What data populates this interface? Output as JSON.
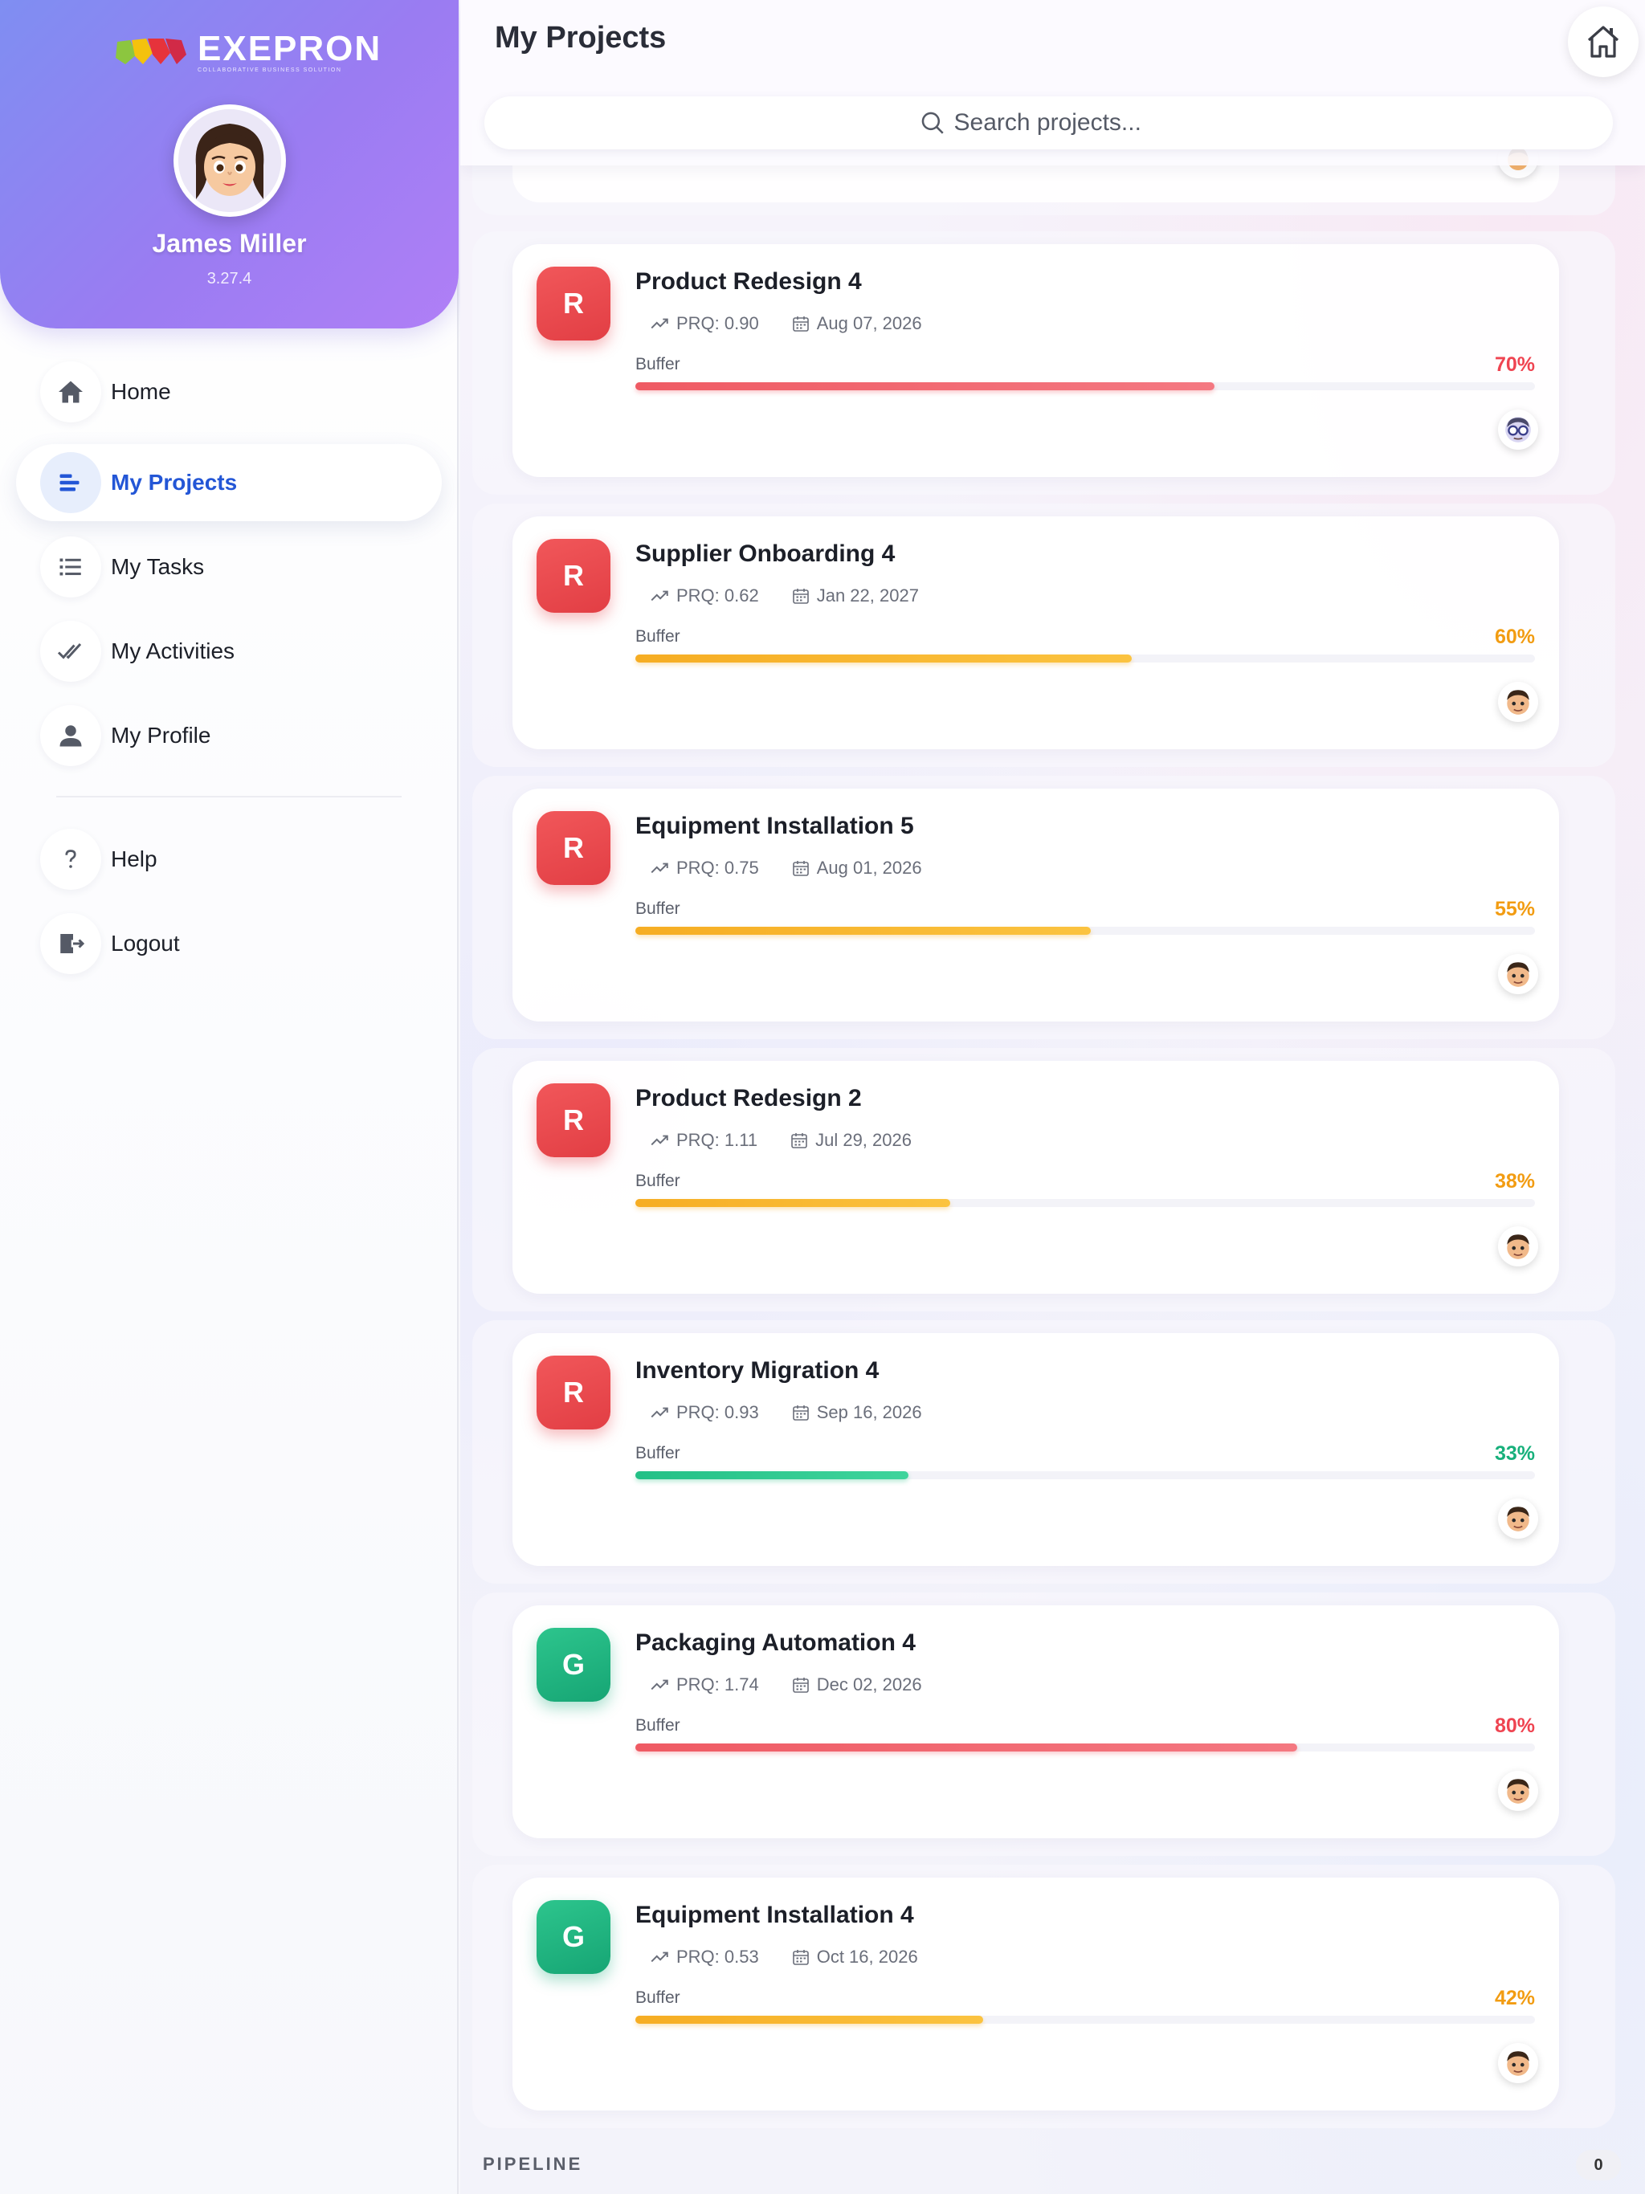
{
  "sidebar": {
    "logo": {
      "text": "EXEPRON",
      "tagline": "COLLABORATIVE BUSINESS SOLUTION"
    },
    "user": {
      "name": "James Miller",
      "version": "3.27.4",
      "avatar_icon": "female-avatar-icon"
    },
    "items": [
      {
        "label": "Home",
        "icon": "home-icon",
        "active": false
      },
      {
        "label": "My Projects",
        "icon": "projects-bars-icon",
        "active": true
      },
      {
        "label": "My Tasks",
        "icon": "list-icon",
        "active": false
      },
      {
        "label": "My Activities",
        "icon": "double-check-icon",
        "active": false
      },
      {
        "label": "My Profile",
        "icon": "person-icon",
        "active": false
      },
      {
        "label": "Help",
        "icon": "question-icon",
        "active": false
      },
      {
        "label": "Logout",
        "icon": "logout-icon",
        "active": false
      }
    ]
  },
  "header": {
    "title": "My Projects",
    "home_icon": "home-outline-icon",
    "search_placeholder": "Search projects..."
  },
  "projects": [
    {
      "badge": "R",
      "badge_color": "red",
      "title": "Product Redesign 4",
      "prq": "PRQ: 0.90",
      "date": "Aug 07, 2026",
      "buffer_label": "Buffer",
      "buffer_pct": 70,
      "buffer_text": "70%",
      "bar_color": "red",
      "owner_icon": "avatar-glasses-icon"
    },
    {
      "badge": "R",
      "badge_color": "red",
      "title": "Supplier Onboarding 4",
      "prq": "PRQ: 0.62",
      "date": "Jan 22, 2027",
      "buffer_label": "Buffer",
      "buffer_pct": 60,
      "buffer_text": "60%",
      "bar_color": "orange",
      "owner_icon": "avatar-man-icon"
    },
    {
      "badge": "R",
      "badge_color": "red",
      "title": "Equipment Installation 5",
      "prq": "PRQ: 0.75",
      "date": "Aug 01, 2026",
      "buffer_label": "Buffer",
      "buffer_pct": 55,
      "buffer_text": "55%",
      "bar_color": "orange",
      "owner_icon": "avatar-man-icon"
    },
    {
      "badge": "R",
      "badge_color": "red",
      "title": "Product Redesign 2",
      "prq": "PRQ: 1.11",
      "date": "Jul 29, 2026",
      "buffer_label": "Buffer",
      "buffer_pct": 38,
      "buffer_text": "38%",
      "bar_color": "orange",
      "owner_icon": "avatar-man-icon"
    },
    {
      "badge": "R",
      "badge_color": "red",
      "title": "Inventory Migration 4",
      "prq": "PRQ: 0.93",
      "date": "Sep 16, 2026",
      "buffer_label": "Buffer",
      "buffer_pct": 33,
      "buffer_text": "33%",
      "bar_color": "green",
      "owner_icon": "avatar-man-icon"
    },
    {
      "badge": "G",
      "badge_color": "green",
      "title": "Packaging Automation 4",
      "prq": "PRQ: 1.74",
      "date": "Dec 02, 2026",
      "buffer_label": "Buffer",
      "buffer_pct": 80,
      "buffer_text": "80%",
      "bar_color": "red",
      "owner_icon": "avatar-man-icon"
    },
    {
      "badge": "G",
      "badge_color": "green",
      "title": "Equipment Installation 4",
      "prq": "PRQ: 0.53",
      "date": "Oct 16, 2026",
      "buffer_label": "Buffer",
      "buffer_pct": 42,
      "buffer_text": "42%",
      "bar_color": "orange",
      "owner_icon": "avatar-man-icon"
    }
  ],
  "pipeline": {
    "label": "PIPELINE",
    "count": "0"
  },
  "colors": {
    "accent": "#2356d6",
    "red": "#ef4451",
    "orange": "#f29c12",
    "green": "#17b07b",
    "profile_gradient_start": "#7f8ef2",
    "profile_gradient_end": "#b07ff6"
  }
}
